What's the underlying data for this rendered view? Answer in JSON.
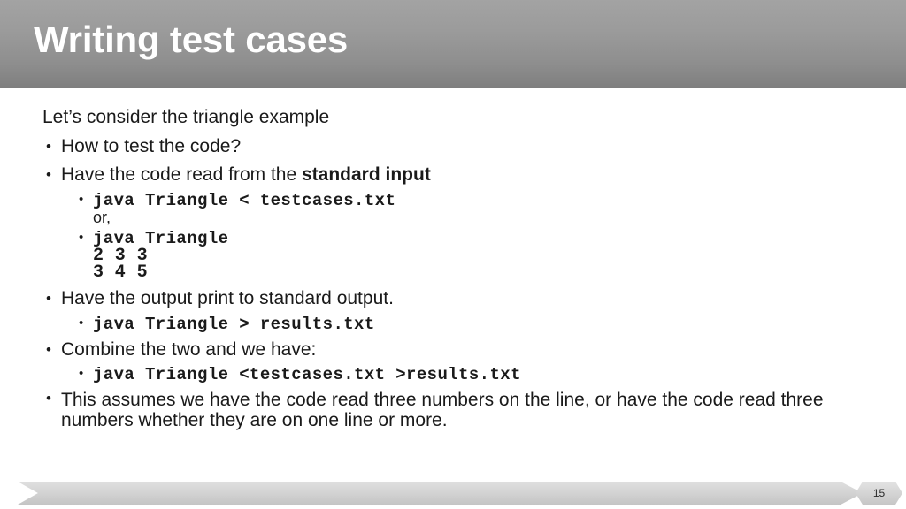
{
  "slide": {
    "title": "Writing test cases",
    "page_number": "15",
    "title_bar_color_top": "#a3a3a3",
    "title_bar_color_bottom": "#7e7e7e",
    "footer_bar_color": "#d4d4d4",
    "text_color": "#1a1a1a",
    "background_color": "#ffffff"
  },
  "body": {
    "intro": "Let’s consider the triangle example",
    "bullet_glyph": "•",
    "b1": "How to test the code?",
    "b2_prefix": "Have the code read from the ",
    "b2_bold": "standard input",
    "code1": "java Triangle < testcases.txt",
    "or_label": "or,",
    "code2": "java Triangle",
    "code2_line2": "2 3 3",
    "code2_line3": "3 4 5",
    "b3": "Have the output print to standard output.",
    "code3": "java Triangle > results.txt",
    "b4": "Combine the two and we have:",
    "code4": "java Triangle <testcases.txt >results.txt",
    "b5": "This assumes we have the code read three numbers on the line, or have the code read three numbers whether they are on one line or more."
  }
}
